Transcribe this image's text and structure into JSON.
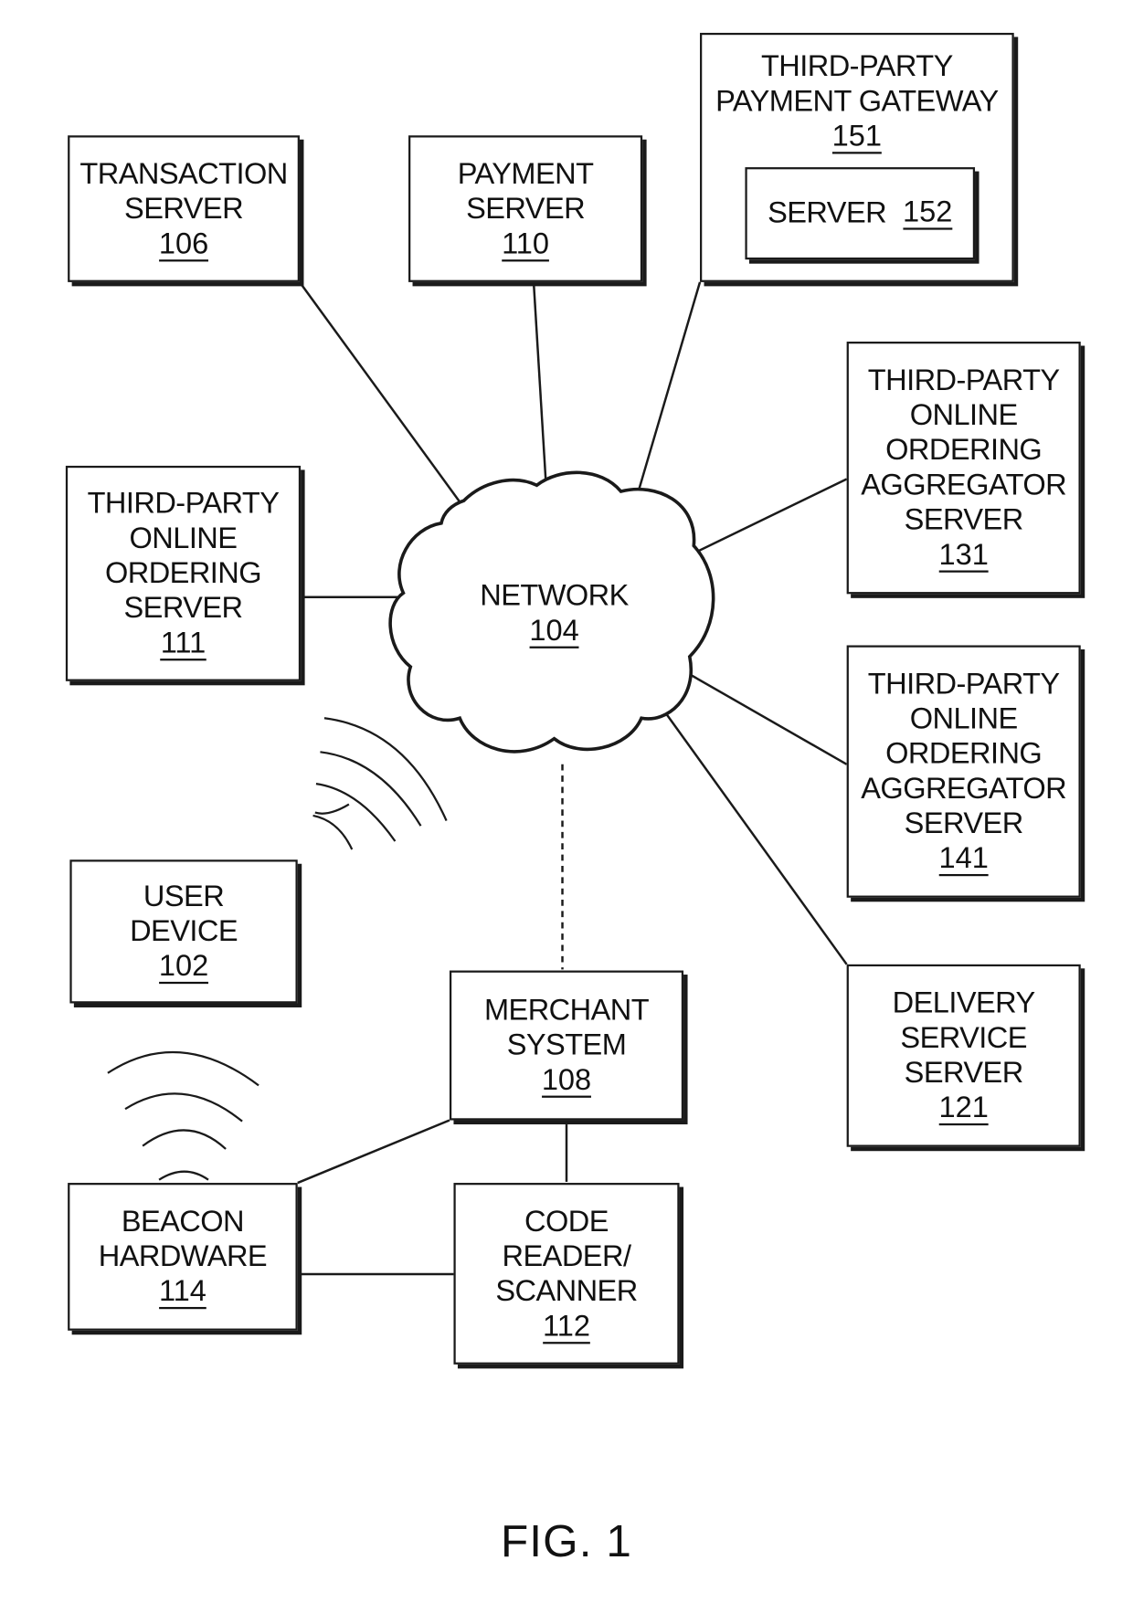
{
  "figure": {
    "caption": "FIG. 1"
  },
  "nodes": {
    "transaction_server": {
      "lines": [
        "TRANSACTION",
        "SERVER"
      ],
      "ref": "106"
    },
    "payment_server": {
      "lines": [
        "PAYMENT",
        "SERVER"
      ],
      "ref": "110"
    },
    "payment_gateway": {
      "lines": [
        "THIRD-PARTY",
        "PAYMENT GATEWAY"
      ],
      "ref": "151",
      "inner": {
        "label": "SERVER",
        "ref": "152"
      }
    },
    "aggregator_131": {
      "lines": [
        "THIRD-PARTY",
        "ONLINE",
        "ORDERING",
        "AGGREGATOR",
        "SERVER"
      ],
      "ref": "131"
    },
    "ordering_server": {
      "lines": [
        "THIRD-PARTY",
        "ONLINE",
        "ORDERING",
        "SERVER"
      ],
      "ref": "111"
    },
    "network": {
      "lines": [
        "NETWORK"
      ],
      "ref": "104"
    },
    "aggregator_141": {
      "lines": [
        "THIRD-PARTY",
        "ONLINE",
        "ORDERING",
        "AGGREGATOR",
        "SERVER"
      ],
      "ref": "141"
    },
    "user_device": {
      "lines": [
        "USER",
        "DEVICE"
      ],
      "ref": "102"
    },
    "merchant_system": {
      "lines": [
        "MERCHANT",
        "SYSTEM"
      ],
      "ref": "108"
    },
    "delivery_server": {
      "lines": [
        "DELIVERY",
        "SERVICE",
        "SERVER"
      ],
      "ref": "121"
    },
    "beacon_hardware": {
      "lines": [
        "BEACON",
        "HARDWARE"
      ],
      "ref": "114"
    },
    "code_reader": {
      "lines": [
        "CODE",
        "READER/",
        "SCANNER"
      ],
      "ref": "112"
    }
  },
  "connections": [
    {
      "from": "transaction_server",
      "to": "network",
      "style": "solid"
    },
    {
      "from": "payment_server",
      "to": "network",
      "style": "solid"
    },
    {
      "from": "payment_gateway",
      "to": "network",
      "style": "solid"
    },
    {
      "from": "aggregator_131",
      "to": "network",
      "style": "solid"
    },
    {
      "from": "ordering_server",
      "to": "network",
      "style": "solid"
    },
    {
      "from": "aggregator_141",
      "to": "network",
      "style": "solid"
    },
    {
      "from": "delivery_server",
      "to": "network",
      "style": "solid"
    },
    {
      "from": "merchant_system",
      "to": "network",
      "style": "dashed"
    },
    {
      "from": "merchant_system",
      "to": "beacon_hardware",
      "style": "solid"
    },
    {
      "from": "merchant_system",
      "to": "code_reader",
      "style": "solid"
    },
    {
      "from": "beacon_hardware",
      "to": "code_reader",
      "style": "solid"
    }
  ],
  "wireless_signals": [
    {
      "source": "user_device",
      "arcs": 4
    },
    {
      "source": "beacon_hardware",
      "arcs": 4
    }
  ]
}
